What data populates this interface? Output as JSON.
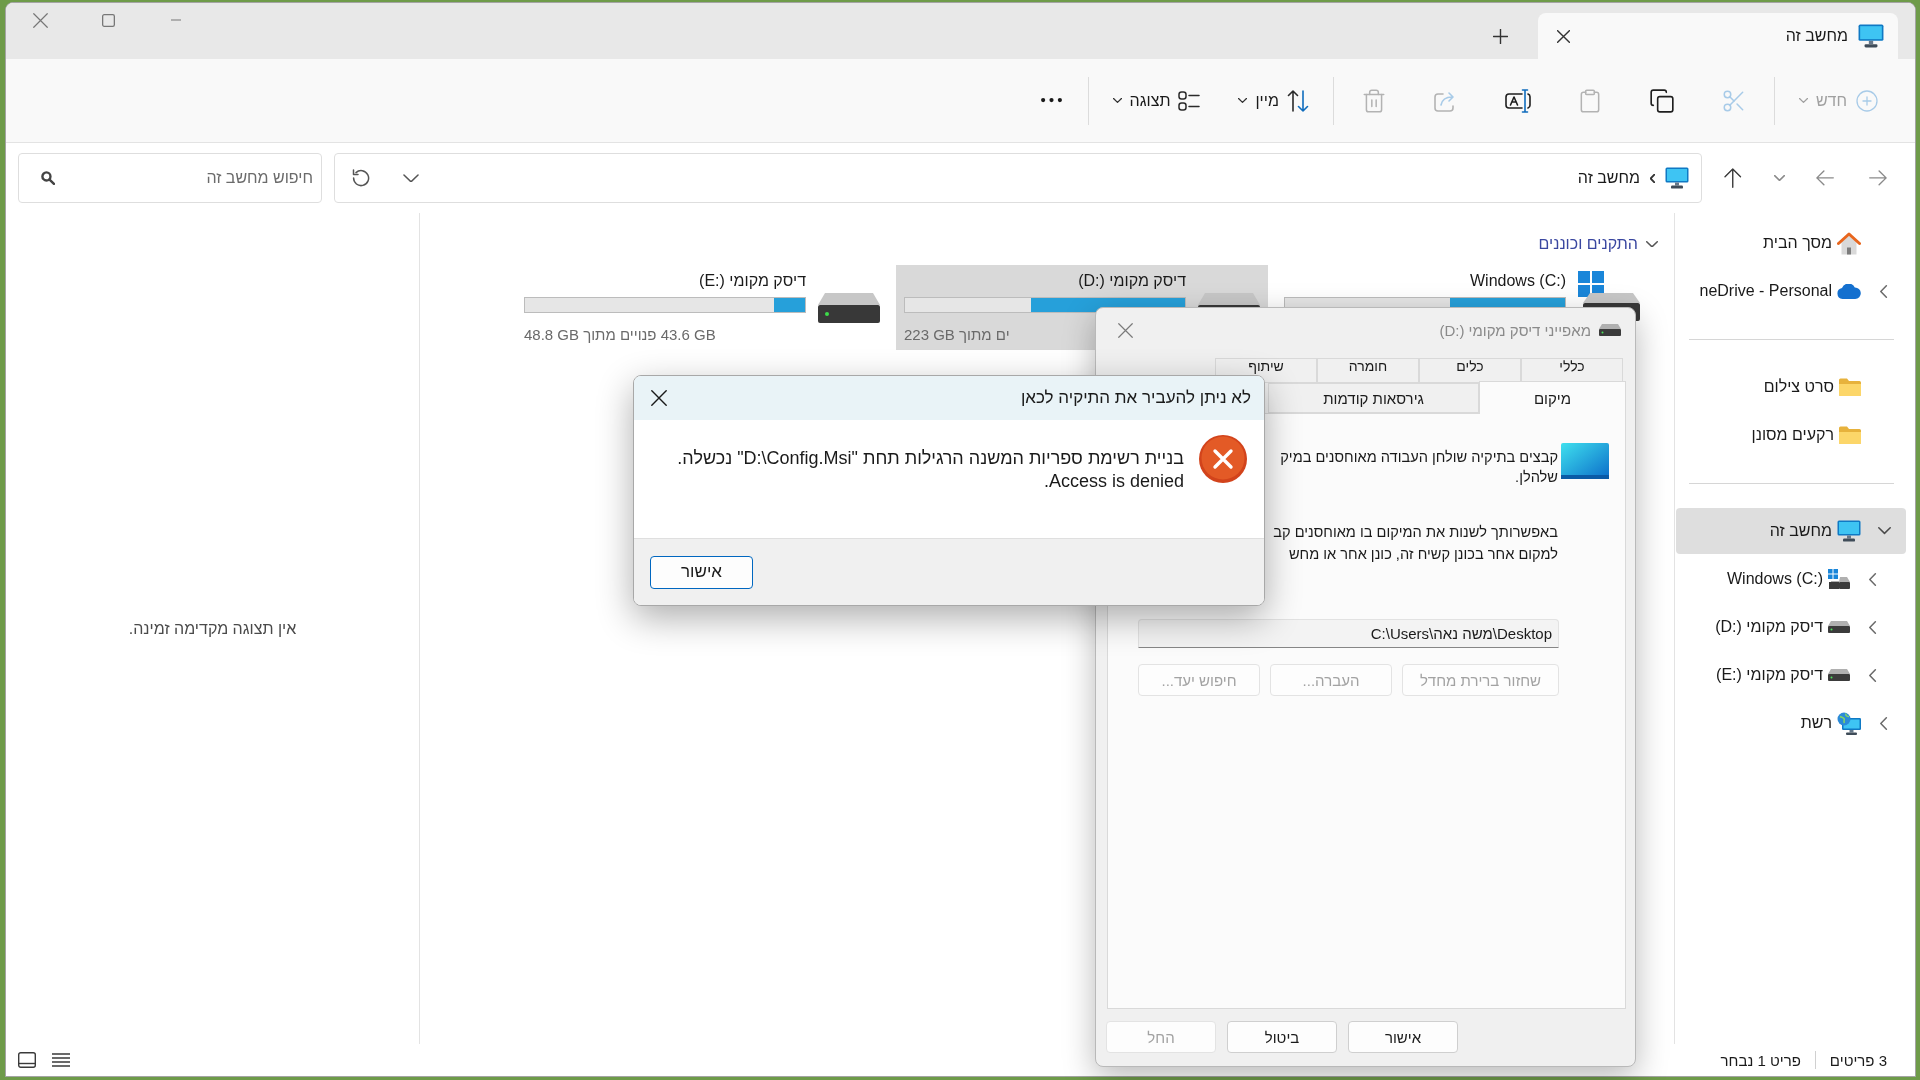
{
  "window": {
    "tabs": [
      {
        "label": "מחשב זה",
        "selected": true
      }
    ]
  },
  "toolbar": {
    "new_menu": {
      "label": "חדש",
      "disabled": true
    },
    "actions": [
      {
        "disabled": true
      },
      {
        "disabled": false
      },
      {
        "disabled": true
      },
      {
        "disabled": false
      },
      {
        "disabled": true
      },
      {
        "disabled": true
      }
    ],
    "sort_menu": {
      "label": "מיין"
    },
    "view_menu": {
      "label": "תצוגה"
    }
  },
  "address_bar": {
    "location": "מחשב זה",
    "search": {
      "placeholder": "חיפוש מחשב זה"
    }
  },
  "sidebar": {
    "groups": [
      {
        "items": [
          {
            "kind": "home",
            "label": "מסך הבית",
            "selected": false
          },
          {
            "kind": "cloud",
            "label": "neDrive - Personal",
            "selected": false,
            "expanded": false
          }
        ]
      },
      {
        "items": [
          {
            "kind": "folder",
            "label": "סרט צילום",
            "selected": false
          },
          {
            "kind": "folder",
            "label": "רקעים מסונן",
            "selected": false
          }
        ]
      },
      {
        "items": [
          {
            "kind": "computer",
            "label": "מחשב זה",
            "selected": true,
            "expanded": true,
            "children": [
              {
                "kind": "windows_drive",
                "label": "Windows (C:)",
                "selected": false,
                "expanded": false
              },
              {
                "kind": "drive",
                "label": "דיסק מקומי (D:‎)",
                "selected": false,
                "expanded": false
              },
              {
                "kind": "drive",
                "label": "דיסק מקומי (E:‎)",
                "selected": false,
                "expanded": false
              }
            ]
          },
          {
            "kind": "network",
            "label": "רשת",
            "selected": false,
            "expanded": false
          }
        ]
      }
    ]
  },
  "content": {
    "section": {
      "title": "התקנים וכוננים",
      "expanded": true
    },
    "drives": [
      {
        "kind": "windows_drive",
        "name": "Windows (C:)",
        "level": 0.41,
        "selected": false
      },
      {
        "kind": "drive",
        "name": "דיסק מקומי (D:‎)",
        "level": 0.55,
        "free_space": "ים מתוך ‎223 GB",
        "selected": true
      },
      {
        "kind": "drive",
        "name": "דיסק מקומי (E:‎)",
        "level": 0.11,
        "free_space": "‎43.6 GB פנויים מתוך ‎48.8 GB",
        "selected": false
      }
    ]
  },
  "preview": {
    "message": "אין תצוגה מקדימה זמינה."
  },
  "status_bar": {
    "item_count": "3 פריטים",
    "selection": "פריט 1 נבחר"
  },
  "properties_dialog": {
    "title": "מאפייני דיסק מקומי (D:‎)",
    "active": false,
    "tab_rows": [
      {
        "tabs": [
          {
            "label": "כללי",
            "selected": false
          },
          {
            "label": "כלים",
            "selected": false
          },
          {
            "label": "חומרה",
            "selected": false
          },
          {
            "label": "שיתוף",
            "selected": false
          }
        ]
      },
      {
        "tabs": [
          {
            "label": "מיקום",
            "selected": true
          },
          {
            "label": "גירסאות קודמות",
            "selected": false
          }
        ]
      }
    ],
    "description": [
      "קבצים בתיקיה שולחן העבודה מאוחסנים במיק",
      "שלהלן."
    ],
    "instructions": [
      "באפשרותך לשנות את המיקום בו מאוחסנים קב",
      "למקום אחר בכונן קשיח זה, כונן אחר או מחש"
    ],
    "path": "C:\\Users\\משה נאה\\Desktop",
    "location_buttons": [
      {
        "label": "שחזור ברירת מחדל",
        "disabled": true
      },
      {
        "label": "העברה...",
        "disabled": true
      },
      {
        "label": "חיפוש יעד...",
        "disabled": true
      }
    ],
    "buttons": [
      {
        "label": "אישור",
        "disabled": false
      },
      {
        "label": "ביטול",
        "disabled": false
      },
      {
        "label": "החל",
        "disabled": true
      }
    ]
  },
  "error_dialog": {
    "title": "לא ניתן להעביר את התיקיה לכאן",
    "message": [
      "בניית רשימת ספריות המשנה הרגילות תחת \"D:\\Config.Msi\" נכשלה.",
      "Access is denied."
    ],
    "button": {
      "label": "אישור",
      "default": true
    }
  }
}
